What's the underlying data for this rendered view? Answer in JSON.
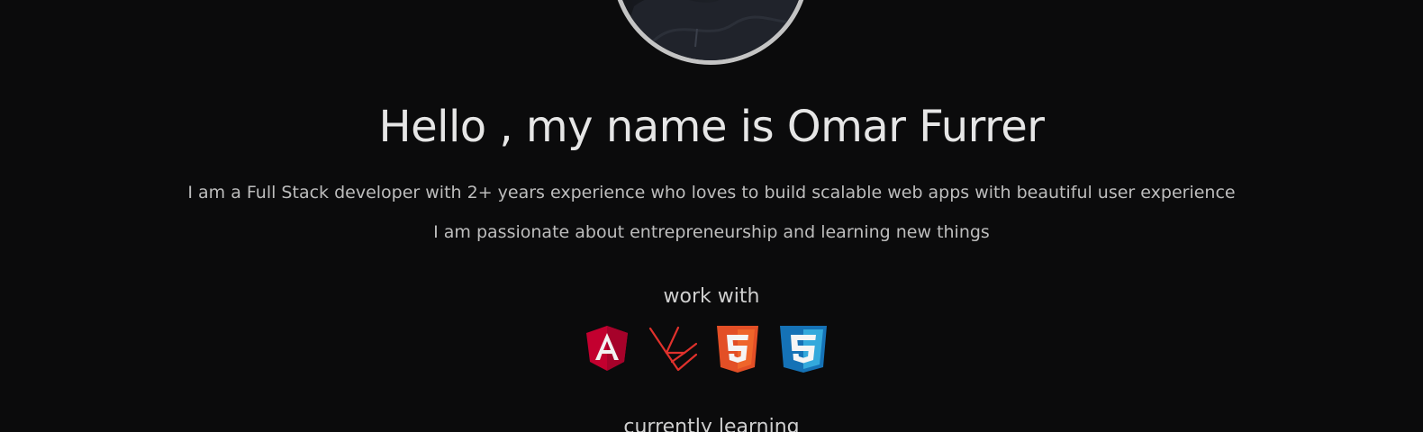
{
  "hero": {
    "heading": "Hello , my name is Omar Furrer",
    "bio_line_1": "I am a Full Stack developer with 2+ years experience who loves to build scalable web apps with beautiful user experience",
    "bio_line_2": "I am passionate about entrepreneurship and learning new things"
  },
  "skills": {
    "work_with_title": "work with",
    "work_with_icons": [
      "angular-icon",
      "laravel-icon",
      "html5-icon",
      "css3-icon"
    ],
    "currently_learning_title": "currently learning"
  },
  "colors": {
    "background": "#0b0b0c",
    "avatar_border": "#c4c4c4",
    "angular_red": "#c3002f",
    "laravel_red": "#e0312c",
    "html5_orange": "#e34f26",
    "css3_blue": "#1572b6"
  }
}
